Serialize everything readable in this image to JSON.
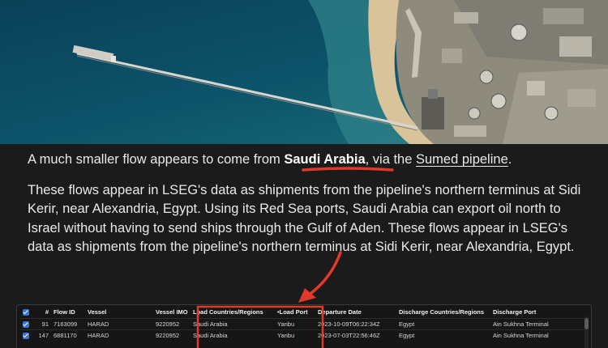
{
  "article": {
    "lead_prefix": "A much smaller flow appears to come from ",
    "lead_country": "Saudi Arabia",
    "lead_mid": ", via the ",
    "lead_link": "Sumed pipeline",
    "lead_suffix": ".",
    "paragraph": "These flows appear in LSEG's data as shipments from the pipeline's northern terminus at Sidi Kerir, near Alexandria, Egypt. Using its Red Sea ports, Saudi Arabia can export oil north to Israel without having to send ships through the Gulf of Aden. These flows appear in LSEG's data as shipments from the pipeline's northern terminus at Sidi Kerir, near Alexandria, Egypt."
  },
  "annotation": {
    "accent_color": "#e0382b"
  },
  "table": {
    "columns": [
      "#",
      "Flow ID",
      "Vessel",
      "Vessel IMO",
      "Load Countries/Regions",
      "•Load Port",
      "Departure Date",
      "Discharge Countries/Regions",
      "Discharge Port"
    ],
    "rows": [
      {
        "index": "91",
        "flow_id": "7163099",
        "vessel": "HARAD",
        "imo": "9220952",
        "load_country": "Saudi Arabia",
        "load_port": "Yanbu",
        "departure": "2023-10-09T06:22:34Z",
        "discharge_country": "Egypt",
        "discharge_port": "Ain Sukhna Terminal"
      },
      {
        "index": "147",
        "flow_id": "6881170",
        "vessel": "HARAD",
        "imo": "9220952",
        "load_country": "Saudi Arabia",
        "load_port": "Yanbu",
        "departure": "2023-07-03T22:56:46Z",
        "discharge_country": "Egypt",
        "discharge_port": "Ain Sukhna Terminal"
      }
    ]
  },
  "icons": {
    "checkbox": "checkbox-checked-icon"
  }
}
